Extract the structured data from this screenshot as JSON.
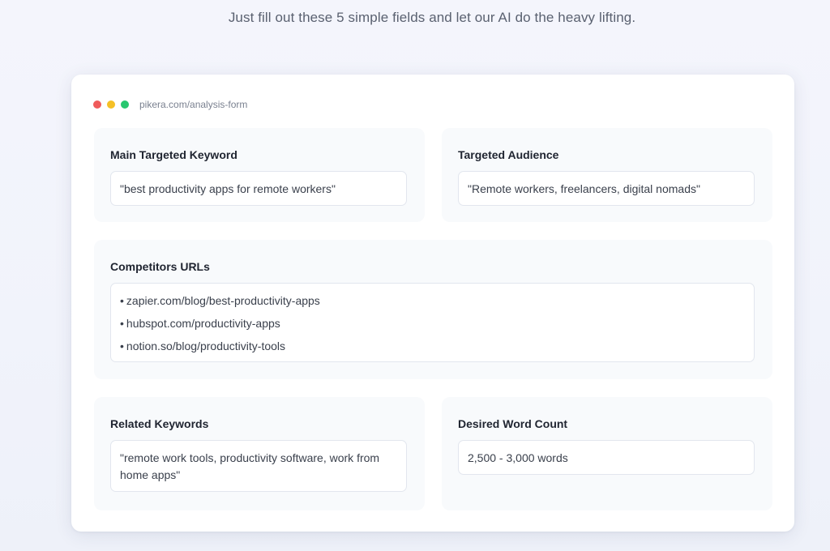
{
  "header": {
    "subtitle": "Just fill out these 5 simple fields and let our AI do the heavy lifting."
  },
  "window": {
    "url": "pikera.com/analysis-form",
    "controls": {
      "close_color": "#ef5b5b",
      "minimize_color": "#f5c026",
      "maximize_color": "#28c76f"
    }
  },
  "form": {
    "main_keyword": {
      "label": "Main Targeted Keyword",
      "value": "\"best productivity apps for remote workers\""
    },
    "audience": {
      "label": "Targeted Audience",
      "value": "\"Remote workers, freelancers, digital nomads\""
    },
    "competitors": {
      "label": "Competitors URLs",
      "bullet": "•",
      "items": [
        "zapier.com/blog/best-productivity-apps",
        "hubspot.com/productivity-apps",
        "notion.so/blog/productivity-tools"
      ]
    },
    "related_keywords": {
      "label": "Related Keywords",
      "value": "\"remote work tools, productivity software, work from home apps\""
    },
    "word_count": {
      "label": "Desired Word Count",
      "value": "2,500 - 3,000 words"
    }
  }
}
